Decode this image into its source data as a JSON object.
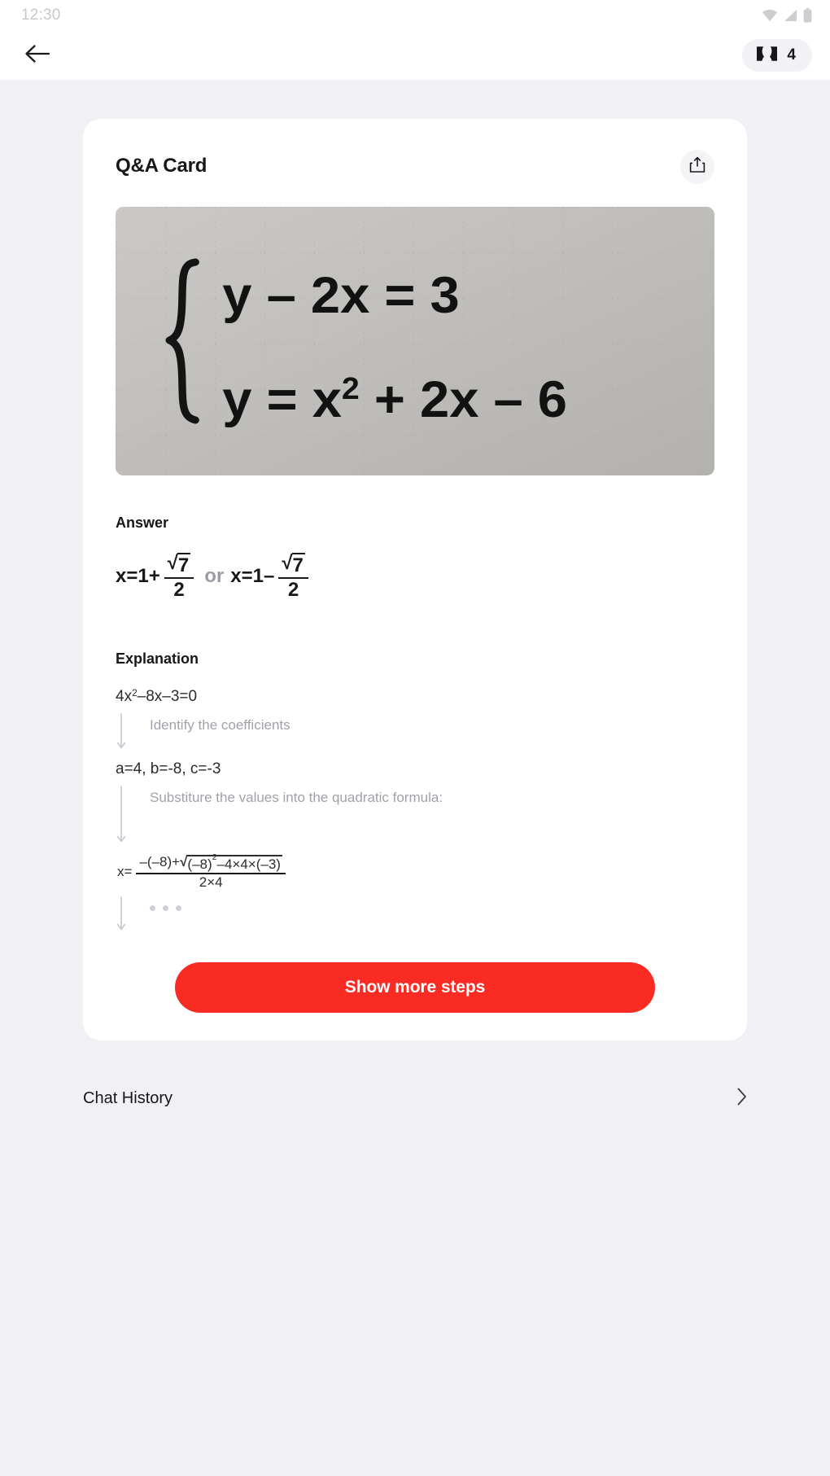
{
  "status_bar": {
    "time": "12:30",
    "icons": [
      "wifi-icon",
      "signal-icon",
      "battery-icon"
    ]
  },
  "app_bar": {
    "back_icon": "back-arrow-icon",
    "ticket": {
      "icon": "ticket-icon",
      "count": "4"
    }
  },
  "card": {
    "title": "Q&A Card",
    "share_icon": "share-icon",
    "problem_image": {
      "alt": "handwritten system of equations on grid paper",
      "bracket": "{",
      "line1": "y – 2x = 3",
      "line2_base": "y = x",
      "line2_sup": "2",
      "line2_rest": " + 2x – 6"
    },
    "answer": {
      "label": "Answer",
      "lhs1": "x=1+",
      "frac1_num_sign": "√",
      "frac1_num_body": "7",
      "frac1_den": "2",
      "connector": "or",
      "lhs2": "x=1–",
      "frac2_num_sign": "√",
      "frac2_num_body": "7",
      "frac2_den": "2"
    },
    "explanation": {
      "label": "Explanation",
      "steps": [
        {
          "expr_pre": "4x",
          "expr_sup": "2",
          "expr_post": "–8x–3=0",
          "note": "Identify the coefficients"
        },
        {
          "expr_pre": "a=4, b=-8, c=-3",
          "expr_sup": "",
          "expr_post": "",
          "note": "Substiture the values into the quadratic formula:"
        }
      ],
      "formula": {
        "lhs": "x=",
        "num_pre": "–(–8)+",
        "num_radical_sign": "√",
        "num_radicand_pre": "(–8)",
        "num_radicand_sup": "2",
        "num_radicand_post": "–4×4×(–3)",
        "den": "2×4"
      },
      "truncated_indicator": "• • •"
    },
    "cta_label": "Show more steps"
  },
  "chat_history": {
    "label": "Chat History",
    "chevron_icon": "chevron-right-icon"
  },
  "colors": {
    "accent_red": "#f92b23",
    "page_bg": "#f1f1f5",
    "card_bg": "#ffffff",
    "muted_text": "#a1a1a9",
    "primary_text": "#17171a"
  }
}
